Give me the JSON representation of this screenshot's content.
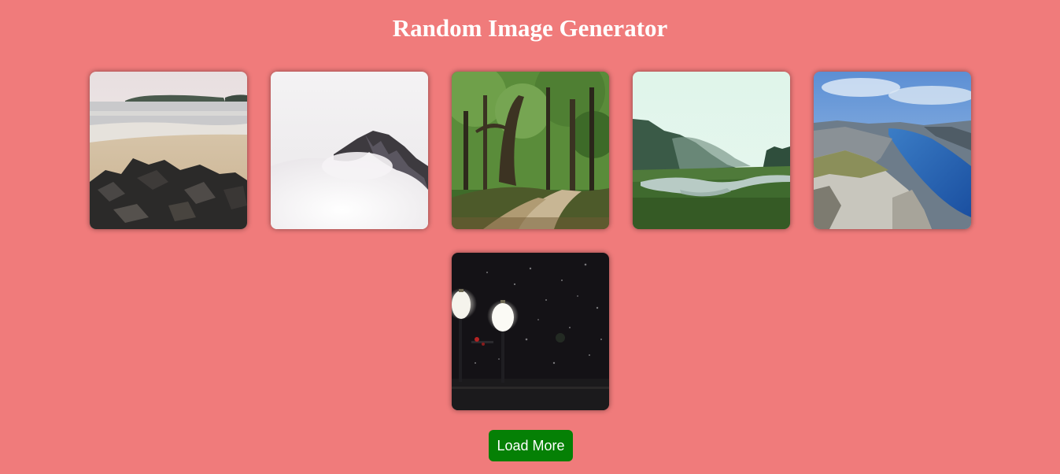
{
  "header": {
    "title": "Random Image Generator"
  },
  "gallery": {
    "images": [
      {
        "subject": "rocky-beach-photo"
      },
      {
        "subject": "misty-mountain-photo"
      },
      {
        "subject": "forest-path-photo"
      },
      {
        "subject": "valley-river-photo"
      },
      {
        "subject": "fjord-cliff-photo"
      },
      {
        "subject": "night-street-lamps-photo"
      }
    ]
  },
  "actions": {
    "load_more_label": "Load More"
  },
  "colors": {
    "background": "#f07b7b",
    "title": "#ffffff",
    "button": "#058005",
    "button_text": "#ffffff"
  }
}
